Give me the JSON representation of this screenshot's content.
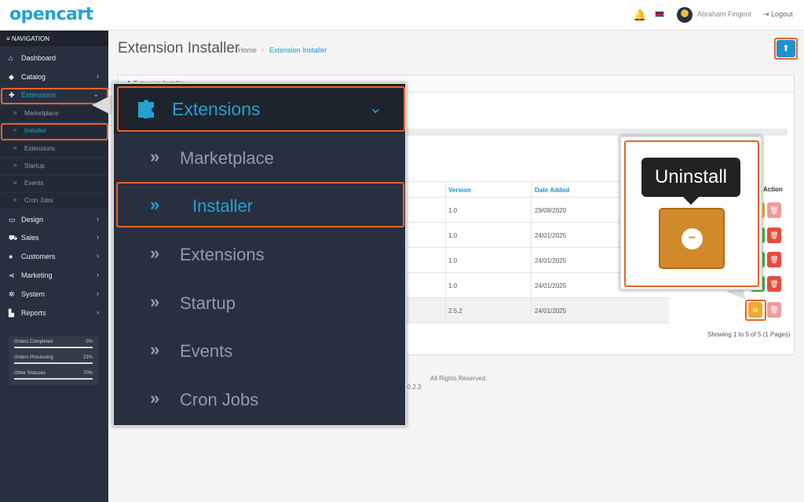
{
  "header": {
    "logo": "opencart",
    "user_name": "Abraham Fingent",
    "logout": "Logout"
  },
  "sidebar": {
    "title": "NAVIGATION",
    "items": [
      {
        "label": "Dashboard",
        "icon": "home-icon"
      },
      {
        "label": "Catalog",
        "icon": "tag-icon"
      },
      {
        "label": "Extensions",
        "icon": "puzzle-icon"
      },
      {
        "label": "Design",
        "icon": "monitor-icon"
      },
      {
        "label": "Sales",
        "icon": "cart-icon"
      },
      {
        "label": "Customers",
        "icon": "user-icon"
      },
      {
        "label": "Marketing",
        "icon": "share-icon"
      },
      {
        "label": "System",
        "icon": "gear-icon"
      },
      {
        "label": "Reports",
        "icon": "chart-icon"
      }
    ],
    "sub_items": [
      "Marketplace",
      "Installer",
      "Extensions",
      "Startup",
      "Events",
      "Cron Jobs"
    ],
    "stats": [
      {
        "label": "Orders Completed",
        "value": "0%"
      },
      {
        "label": "Orders Processing",
        "value": "23%"
      },
      {
        "label": "Other Statuses",
        "value": "70%"
      }
    ]
  },
  "main": {
    "title": "Extension Installer",
    "breadcrumb": [
      "Home",
      "Extension Installer"
    ],
    "panel_title": "Extension Installer",
    "table": {
      "headers": [
        "Version",
        "Date Added",
        "Action"
      ],
      "rows": [
        [
          "1.0",
          "29/08/2020"
        ],
        [
          "1.0",
          "24/01/2025"
        ],
        [
          "1.0",
          "24/01/2025"
        ],
        [
          "1.0",
          "24/01/2025"
        ],
        [
          "2.5.2",
          "24/01/2025"
        ]
      ]
    },
    "showing": "Showing 1 to 5 of 5 (1 Pages)",
    "footer_rights": "All Rights Reserved.",
    "footer_version": "4.0.2.3"
  },
  "zoom": {
    "header": "Extensions",
    "items": [
      "Marketplace",
      "Installer",
      "Extensions",
      "Startup",
      "Events",
      "Cron Jobs"
    ]
  },
  "uninstall_zoom": {
    "tooltip": "Uninstall"
  },
  "colors": {
    "accent": "#23a1d1",
    "highlight": "#e8632a",
    "sidebar": "#283040",
    "uninstall": "#d08a2c"
  }
}
